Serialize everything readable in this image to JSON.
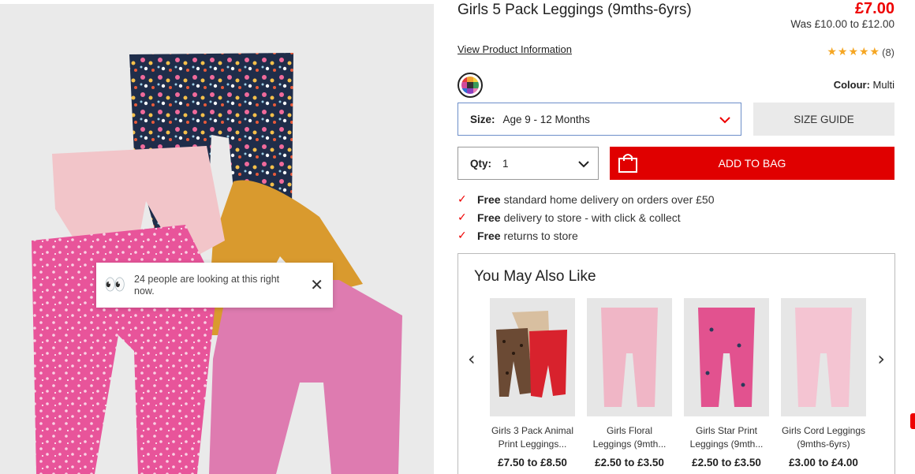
{
  "product": {
    "title": "Girls 5 Pack Leggings (9mths-6yrs)",
    "price": "£7.00",
    "was_price": "Was £10.00 to £12.00",
    "view_info_link": "View Product Information",
    "rating_stars": "★★★★★",
    "rating_count": "(8)",
    "colour_label": "Colour:",
    "colour_value": "Multi"
  },
  "toast": {
    "message": "24 people are looking at this right now.",
    "eyes": "👀",
    "close": "✕"
  },
  "size": {
    "label": "Size:",
    "value": "Age 9 - 12 Months",
    "guide_button": "SIZE GUIDE"
  },
  "qty": {
    "label": "Qty:",
    "value": "1"
  },
  "add_to_bag": "ADD TO BAG",
  "delivery": [
    {
      "bold": "Free",
      "text": "standard home delivery on orders over £50"
    },
    {
      "bold": "Free",
      "text": "delivery to store - with click & collect"
    },
    {
      "bold": "Free",
      "text": "returns to store"
    }
  ],
  "recommendations": {
    "heading": "You May Also Like",
    "prev": "‹",
    "next": "›",
    "items": [
      {
        "name": "Girls 3 Pack Animal Print Leggings...",
        "price": "£7.50 to £8.50"
      },
      {
        "name": "Girls Floral Leggings (9mth...",
        "price": "£2.50 to £3.50"
      },
      {
        "name": "Girls Star Print Leggings (9mth...",
        "price": "£2.50 to £3.50"
      },
      {
        "name": "Girls Cord Leggings (9mths-6yrs)",
        "price": "£3.00 to £4.00"
      }
    ]
  },
  "colors": {
    "accent_red": "#e00000",
    "star": "#f5a623",
    "focus_blue": "#6c8ec9"
  }
}
